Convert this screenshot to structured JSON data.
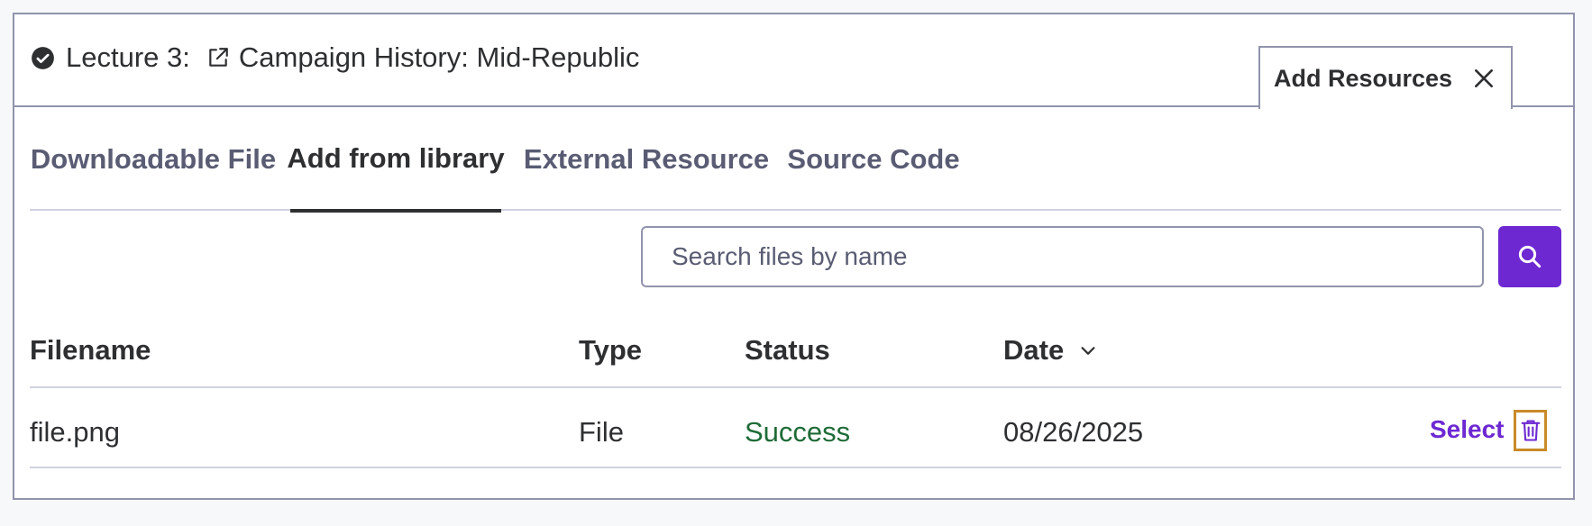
{
  "header": {
    "lecture_label": "Lecture 3:",
    "lecture_title": "Campaign History: Mid-Republic",
    "panel_tab_label": "Add Resources"
  },
  "tabs": [
    {
      "label": "Downloadable File",
      "active": false
    },
    {
      "label": "Add from library",
      "active": true
    },
    {
      "label": "External Resource",
      "active": false
    },
    {
      "label": "Source Code",
      "active": false
    }
  ],
  "search": {
    "placeholder": "Search files by name",
    "value": ""
  },
  "table": {
    "columns": [
      "Filename",
      "Type",
      "Status",
      "Date"
    ],
    "sorted_column": "Date",
    "rows": [
      {
        "filename": "file.png",
        "type": "File",
        "status": "Success",
        "date": "08/26/2025",
        "action": "Select"
      }
    ]
  },
  "icons": {
    "lecture_status": "check-circle-icon",
    "lecture_link": "external-link-icon",
    "close": "close-icon",
    "search": "search-icon",
    "sort": "chevron-down-icon",
    "delete": "trash-icon"
  },
  "colors": {
    "accent": "#6d28d2",
    "success": "#1e6b37",
    "text": "#2d2f31",
    "muted": "#595c73",
    "border": "#9194ac",
    "highlight": "#c98a28"
  }
}
